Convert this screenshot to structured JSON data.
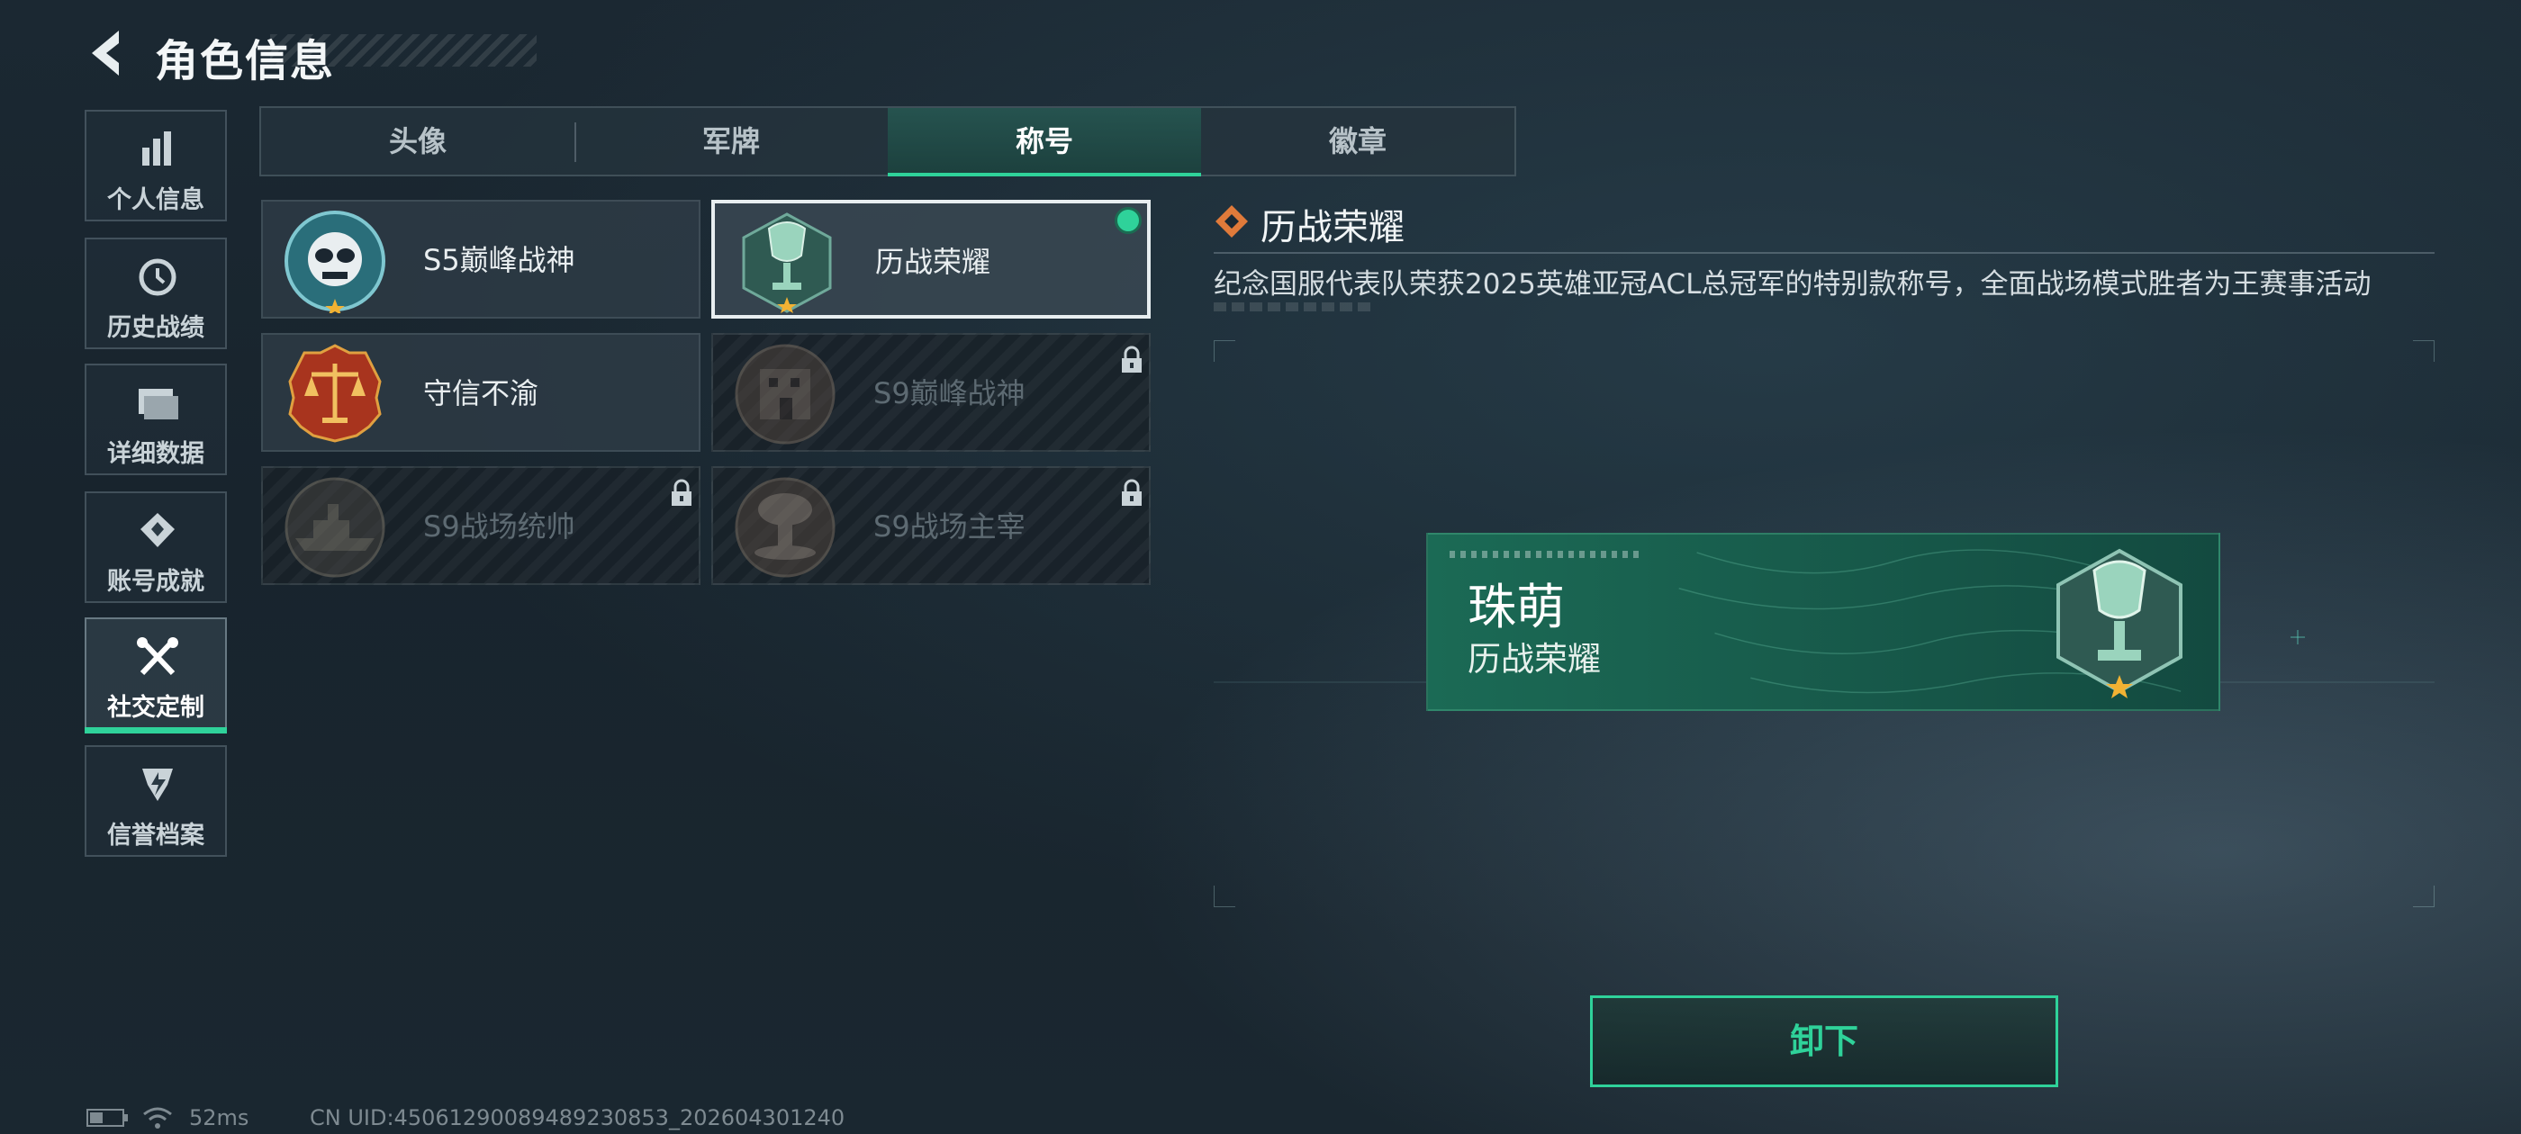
{
  "header": {
    "title": "角色信息"
  },
  "sidebar": {
    "items": [
      {
        "label": "个人信息",
        "icon": "bar-chart-icon"
      },
      {
        "label": "历史战绩",
        "icon": "history-icon"
      },
      {
        "label": "详细数据",
        "icon": "folder-icon"
      },
      {
        "label": "账号成就",
        "icon": "achievement-icon"
      },
      {
        "label": "社交定制",
        "icon": "tools-icon",
        "active": true
      },
      {
        "label": "信誉档案",
        "icon": "credit-icon"
      }
    ]
  },
  "tabs": [
    {
      "label": "头像"
    },
    {
      "label": "军牌"
    },
    {
      "label": "称号",
      "active": true
    },
    {
      "label": "徽章"
    }
  ],
  "titles": [
    {
      "name": "S5巅峰战神",
      "locked": false,
      "selected": false
    },
    {
      "name": "历战荣耀",
      "locked": false,
      "selected": true,
      "equipped": true
    },
    {
      "name": "守信不渝",
      "locked": false,
      "selected": false
    },
    {
      "name": "S9巅峰战神",
      "locked": true,
      "selected": false
    },
    {
      "name": "S9战场统帅",
      "locked": true,
      "selected": false
    },
    {
      "name": "S9战场主宰",
      "locked": true,
      "selected": false
    }
  ],
  "detail": {
    "title": "历战荣耀",
    "description": "纪念国服代表队荣获2025英雄亚冠ACL总冠军的特别款称号，全面战场模式胜者为王赛事活动"
  },
  "preview": {
    "player_name": "珠萌",
    "title": "历战荣耀"
  },
  "actions": {
    "unequip_label": "卸下"
  },
  "status": {
    "ping": "52ms",
    "uid": "CN UID:45061290089489230853_202604301240"
  },
  "colors": {
    "accent": "#2fd29a",
    "preview_bg": "#1b6a55",
    "detail_icon": "#e07a3a"
  }
}
